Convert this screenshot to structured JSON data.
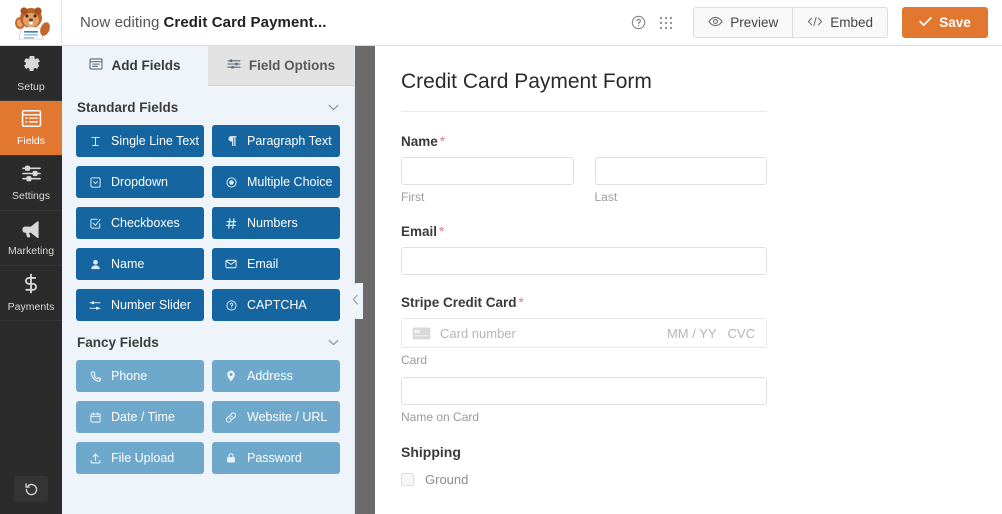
{
  "topbar": {
    "logo_icon": "wpforms-beaver-logo",
    "editing_label": "Now editing",
    "form_name": "Credit Card Payment...",
    "help_icon": "help-circle-icon",
    "apps_icon": "grid-apps-icon",
    "preview_label": "Preview",
    "preview_icon": "eye-icon",
    "embed_label": "Embed",
    "embed_icon": "code-icon",
    "save_label": "Save",
    "save_icon": "check-icon",
    "save_color": "#e27730"
  },
  "leftnav": {
    "items": [
      {
        "label": "Setup",
        "icon": "gear-icon",
        "active": false
      },
      {
        "label": "Fields",
        "icon": "list-icon",
        "active": true
      },
      {
        "label": "Settings",
        "icon": "sliders-icon",
        "active": false
      },
      {
        "label": "Marketing",
        "icon": "megaphone-icon",
        "active": false
      },
      {
        "label": "Payments",
        "icon": "dollar-icon",
        "active": false
      }
    ],
    "revision_icon": "revision-history-icon",
    "active_color": "#e27730",
    "bg_color": "#2b2b2b"
  },
  "panel": {
    "tabs": [
      {
        "label": "Add Fields",
        "icon": "add-fields-icon",
        "active": true
      },
      {
        "label": "Field Options",
        "icon": "field-options-icon",
        "active": false
      }
    ],
    "groups": [
      {
        "title": "Standard Fields",
        "chevron": "chevron-down-icon",
        "style": "standard",
        "color": "#1565a0",
        "fields": [
          {
            "label": "Single Line Text",
            "icon": "text-cursor-icon"
          },
          {
            "label": "Paragraph Text",
            "icon": "pilcrow-icon"
          },
          {
            "label": "Dropdown",
            "icon": "dropdown-icon"
          },
          {
            "label": "Multiple Choice",
            "icon": "radio-icon"
          },
          {
            "label": "Checkboxes",
            "icon": "checkbox-icon"
          },
          {
            "label": "Numbers",
            "icon": "hash-icon"
          },
          {
            "label": "Name",
            "icon": "user-icon"
          },
          {
            "label": "Email",
            "icon": "envelope-icon"
          },
          {
            "label": "Number Slider",
            "icon": "slider-icon"
          },
          {
            "label": "CAPTCHA",
            "icon": "question-circle-icon"
          }
        ]
      },
      {
        "title": "Fancy Fields",
        "chevron": "chevron-down-icon",
        "style": "fancy",
        "color": "#6ea8ca",
        "fields": [
          {
            "label": "Phone",
            "icon": "phone-icon"
          },
          {
            "label": "Address",
            "icon": "map-pin-icon"
          },
          {
            "label": "Date / Time",
            "icon": "calendar-icon"
          },
          {
            "label": "Website / URL",
            "icon": "link-icon"
          },
          {
            "label": "File Upload",
            "icon": "upload-icon"
          },
          {
            "label": "Password",
            "icon": "lock-icon"
          }
        ]
      }
    ]
  },
  "divider": {
    "collapse_icon": "chevron-left-icon"
  },
  "preview": {
    "form_title": "Credit Card Payment Form",
    "required_marker": "*",
    "fields": [
      {
        "label": "Name",
        "required": true,
        "sub_first": "First",
        "sub_last": "Last"
      },
      {
        "label": "Email",
        "required": true
      },
      {
        "label": "Stripe Credit Card",
        "required": true,
        "card_icon": "credit-card-icon",
        "card_placeholder": "Card number",
        "expiry_placeholder": "MM / YY",
        "cvc_placeholder": "CVC",
        "card_sublabel": "Card",
        "name_sublabel": "Name on Card"
      },
      {
        "label": "Shipping",
        "required": false,
        "option_label": "Ground"
      }
    ]
  }
}
